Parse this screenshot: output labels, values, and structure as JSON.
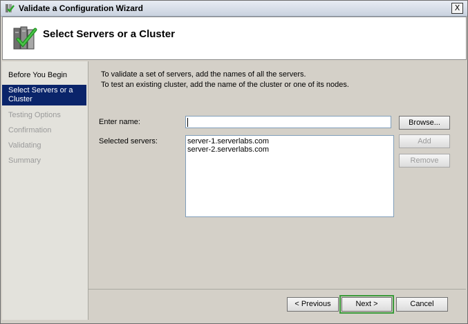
{
  "window": {
    "title": "Validate a Configuration Wizard",
    "close_label": "X"
  },
  "header": {
    "title": "Select Servers or a Cluster"
  },
  "nav": {
    "items": [
      {
        "label": "Before You Begin",
        "state": "enabled"
      },
      {
        "label": "Select Servers or a Cluster",
        "state": "active"
      },
      {
        "label": "Testing Options",
        "state": "disabled"
      },
      {
        "label": "Confirmation",
        "state": "disabled"
      },
      {
        "label": "Validating",
        "state": "disabled"
      },
      {
        "label": "Summary",
        "state": "disabled"
      }
    ]
  },
  "content": {
    "instruction_1": "To validate a set of servers, add the names of all the servers.",
    "instruction_2": "To test an existing cluster, add the name of the cluster or one of its nodes.",
    "enter_name_label": "Enter name:",
    "enter_name_value": "",
    "selected_servers_label": "Selected servers:",
    "selected_servers": [
      "server-1.serverlabs.com",
      "server-2.serverlabs.com"
    ],
    "browse_label": "Browse...",
    "add_label": "Add",
    "remove_label": "Remove"
  },
  "footer": {
    "previous_label": "< Previous",
    "next_label": "Next >",
    "cancel_label": "Cancel"
  },
  "colors": {
    "active_nav": "#0a246a",
    "default_button_outline": "#3a9a3a",
    "nav_background": "#e3e2dc"
  },
  "icons": {
    "title": "wizard-icon",
    "header": "server-cluster-check-icon"
  }
}
